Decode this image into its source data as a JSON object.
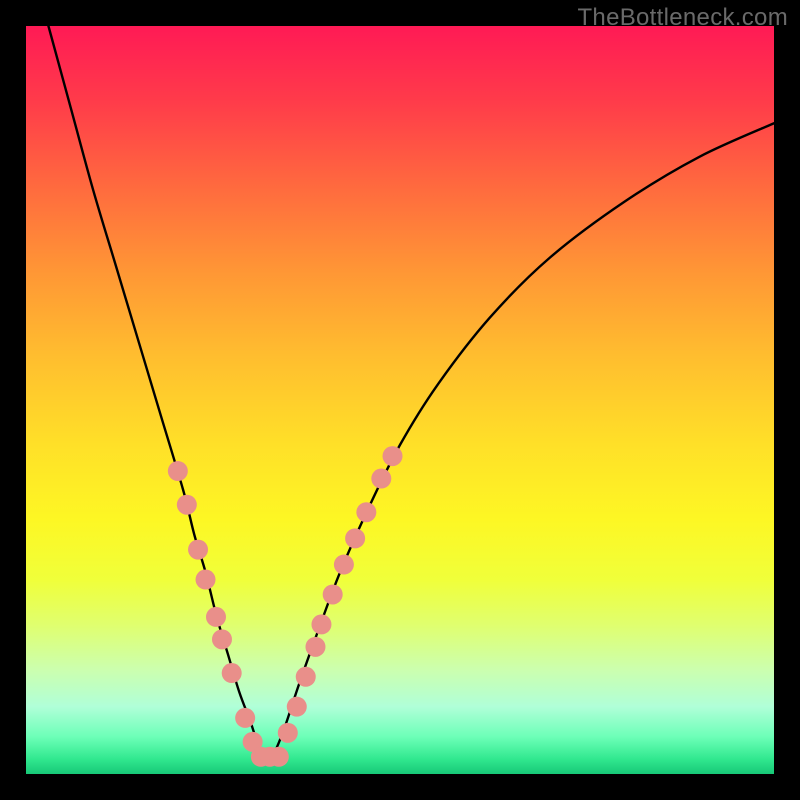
{
  "watermark": "TheBottleneck.com",
  "colors": {
    "background": "#000000",
    "curve": "#000000",
    "marker": "#e98f8a",
    "gradient_top": "#ff1a55",
    "gradient_bottom": "#17c877"
  },
  "chart_data": {
    "type": "line",
    "title": "",
    "xlabel": "",
    "ylabel": "",
    "xlim": [
      0,
      100
    ],
    "ylim": [
      0,
      100
    ],
    "grid": false,
    "legend": false,
    "series": [
      {
        "name": "bottleneck-curve",
        "x": [
          3,
          6,
          9,
          12,
          15,
          18,
          21,
          22.5,
          24,
          25.5,
          27,
          28.5,
          30,
          31,
          32,
          33,
          34.5,
          36.5,
          39,
          42,
          46,
          50,
          55,
          62,
          70,
          80,
          90,
          100
        ],
        "y": [
          100,
          89,
          78,
          68,
          58,
          48,
          38,
          32,
          27,
          21,
          16,
          11,
          7,
          4,
          2,
          2.5,
          6,
          12,
          19,
          27,
          36,
          44,
          52,
          61,
          69,
          76.5,
          82.5,
          87
        ]
      }
    ],
    "markers": [
      {
        "name": "highlight-points",
        "points": [
          {
            "x": 20.3,
            "y": 40.5
          },
          {
            "x": 21.5,
            "y": 36.0
          },
          {
            "x": 23.0,
            "y": 30.0
          },
          {
            "x": 24.0,
            "y": 26.0
          },
          {
            "x": 25.4,
            "y": 21.0
          },
          {
            "x": 26.2,
            "y": 18.0
          },
          {
            "x": 27.5,
            "y": 13.5
          },
          {
            "x": 29.3,
            "y": 7.5
          },
          {
            "x": 30.3,
            "y": 4.3
          },
          {
            "x": 31.4,
            "y": 2.3
          },
          {
            "x": 32.6,
            "y": 2.3
          },
          {
            "x": 33.8,
            "y": 2.3
          },
          {
            "x": 35.0,
            "y": 5.5
          },
          {
            "x": 36.2,
            "y": 9.0
          },
          {
            "x": 37.4,
            "y": 13.0
          },
          {
            "x": 38.7,
            "y": 17.0
          },
          {
            "x": 39.5,
            "y": 20.0
          },
          {
            "x": 41.0,
            "y": 24.0
          },
          {
            "x": 42.5,
            "y": 28.0
          },
          {
            "x": 44.0,
            "y": 31.5
          },
          {
            "x": 45.5,
            "y": 35.0
          },
          {
            "x": 47.5,
            "y": 39.5
          },
          {
            "x": 49.0,
            "y": 42.5
          }
        ]
      }
    ]
  }
}
